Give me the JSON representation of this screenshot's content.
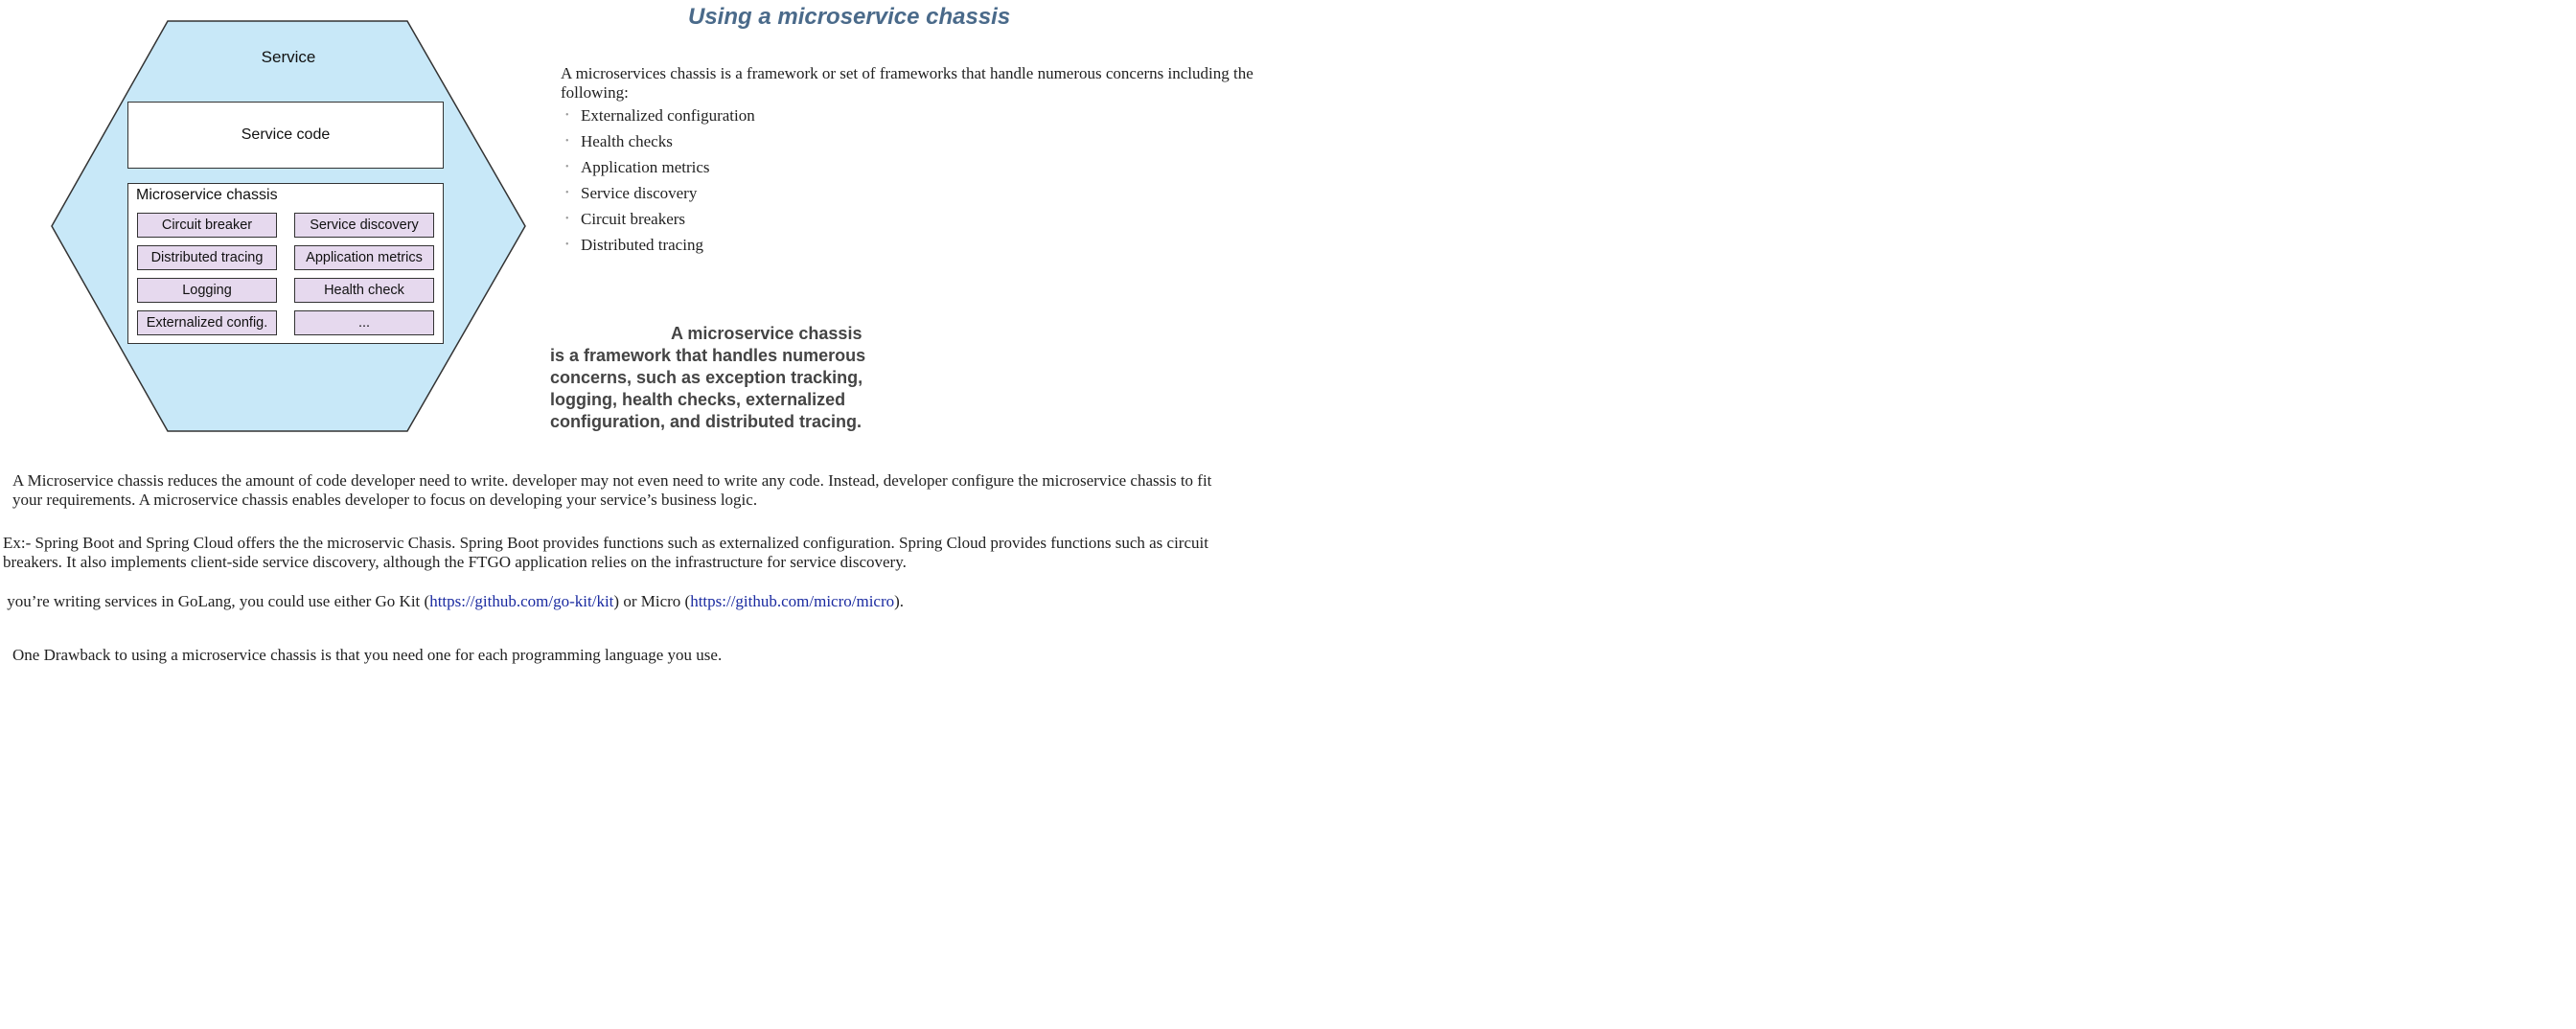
{
  "diagram": {
    "service_label": "Service",
    "service_code_label": "Service code",
    "chassis_label": "Microservice chassis",
    "chassis_items": [
      "Circuit breaker",
      "Service discovery",
      "Distributed tracing",
      "Application metrics",
      "Logging",
      "Health check",
      "Externalized config.",
      "..."
    ],
    "colors": {
      "hexagon_fill": "#c8e8f8",
      "item_fill": "#e6d9ee"
    }
  },
  "title": "Using a microservice chassis",
  "intro": "A microservices chassis is a framework or set of frameworks that handle numerous concerns including the following:",
  "bullets": [
    "Externalized configuration",
    "Health checks",
    "Application metrics",
    "Service discovery",
    "Circuit breakers",
    "Distributed tracing"
  ],
  "callout_first": "A microservice chassis",
  "callout_rest": "is a framework that handles numerous concerns, such as exception tracking, logging, health checks, externalized configuration, and distributed tracing.",
  "para1": "A Microservice chassis  reduces the amount of code developer need to write. developer  may not even need to write any code. Instead, developer  configure the microservice chassis to fit your requirements. A microservice chassis enables developer to focus on developing your service’s business logic.",
  "para2": "Ex:- Spring Boot and Spring Cloud offers the  the microservic Chasis. Spring Boot provides functions such as externalized configuration. Spring Cloud provides functions such as circuit breakers. It also implements client-side service discovery, although the FTGO application relies on the infrastructure for service discovery.",
  "para3": {
    "prefix": " you’re writing services in GoLang, you could use either Go Kit (",
    "link1": "https://github.com/go-kit/kit",
    "middle": ") or Micro (",
    "link2": "https://github.com/micro/micro",
    "suffix": ")."
  },
  "para4": "One Drawback to using a microservice chassis is that you need one for each programming language you use."
}
